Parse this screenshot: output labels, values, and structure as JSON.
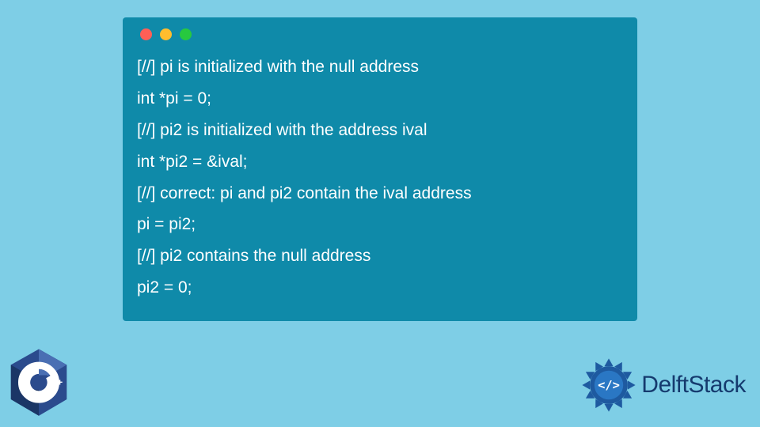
{
  "code": {
    "lines": [
      "[//] pi is initialized with the null address",
      "int *pi = 0;",
      "[//] pi2 is initialized with the address ival",
      "int *pi2 = &ival;",
      "[//] correct: pi and pi2 contain the ival address",
      "pi = pi2;",
      "[//] pi2 contains the null address",
      "pi2 = 0;"
    ]
  },
  "window": {
    "dots": {
      "red": "#ff5f56",
      "yellow": "#ffbd2e",
      "green": "#27c93f"
    }
  },
  "badges": {
    "cpp": "C++",
    "delft": "DelftStack"
  },
  "colors": {
    "background": "#7ecee6",
    "window": "#0f8aa9",
    "codeText": "#ffffff",
    "delftBlue": "#153a6e",
    "gearOuter": "#1e5aa0",
    "gearInner": "#2a77c4"
  }
}
